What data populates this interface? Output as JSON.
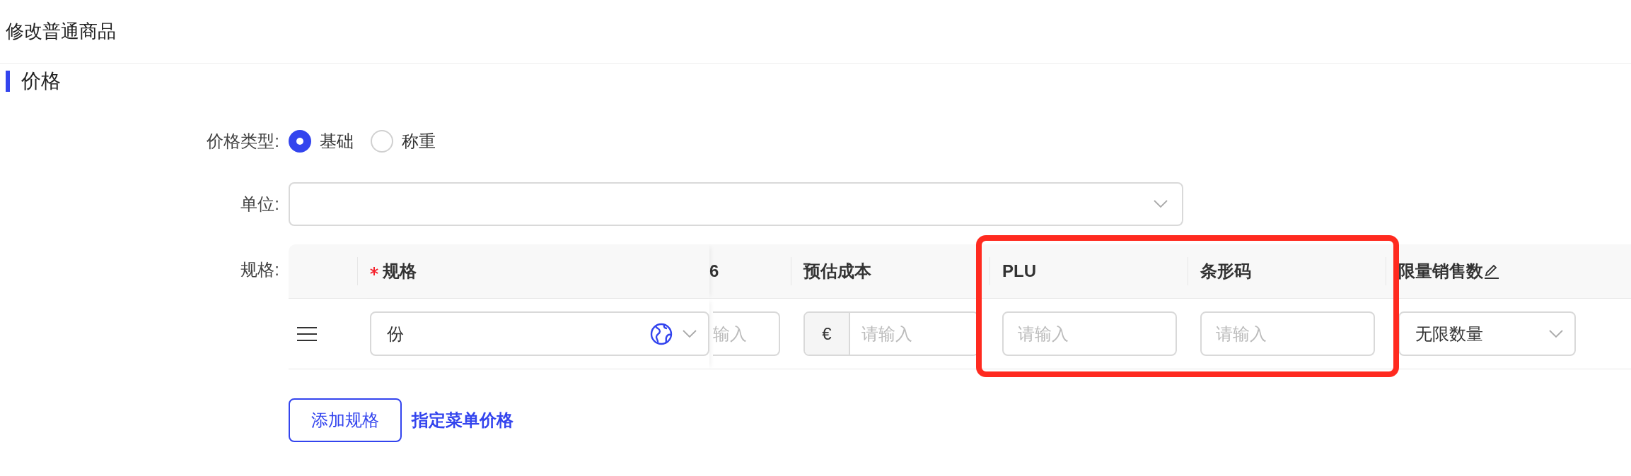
{
  "page_title": "修改普通商品",
  "section": {
    "title": "价格"
  },
  "price_type": {
    "label": "价格类型:",
    "options": [
      {
        "label": "基础",
        "selected": true
      },
      {
        "label": "称重",
        "selected": false
      }
    ]
  },
  "unit": {
    "label": "单位:"
  },
  "specs": {
    "label": "规格:",
    "columns": [
      {
        "kind": "handle"
      },
      {
        "kind": "data",
        "label": "规格",
        "required": true
      },
      {
        "kind": "data",
        "label": "6",
        "required": false
      },
      {
        "kind": "data",
        "label": "预估成本",
        "required": false
      },
      {
        "kind": "data",
        "label": "PLU",
        "required": false
      },
      {
        "kind": "data",
        "label": "条形码",
        "required": false
      },
      {
        "kind": "data",
        "label": "限量销售数",
        "required": false,
        "editable": true
      }
    ],
    "annotation": {
      "kind": "highlight-frame"
    },
    "rows": [
      {
        "cells": [
          {
            "kind": "handle"
          },
          {
            "kind": "select",
            "value": "份",
            "translatable": true
          },
          {
            "kind": "input",
            "placeholder": "输入"
          },
          {
            "kind": "currency",
            "prefix": "€",
            "placeholder": "请输入"
          },
          {
            "kind": "input",
            "placeholder": "请输入"
          },
          {
            "kind": "input",
            "placeholder": "请输入"
          },
          {
            "kind": "select",
            "value": "无限数量",
            "translatable": false
          }
        ]
      }
    ]
  },
  "actions": [
    {
      "kind": "outline",
      "label": "添加规格"
    },
    {
      "kind": "link",
      "label": "指定菜单价格"
    }
  ]
}
